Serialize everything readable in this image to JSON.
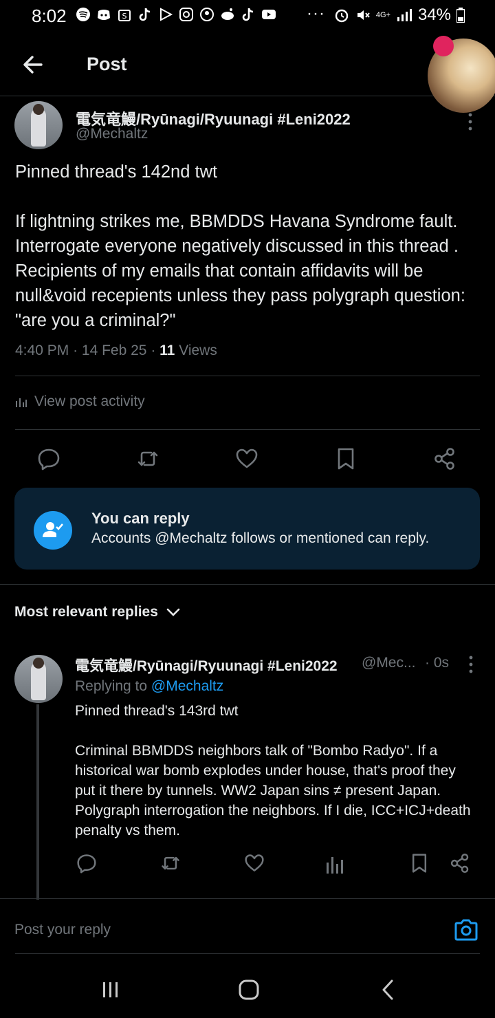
{
  "status_bar": {
    "time": "8:02",
    "overflow": "···",
    "network": "4G+",
    "battery": "34%"
  },
  "header": {
    "title": "Post"
  },
  "post": {
    "author_name": "電気竜鰻/Ryūnagi/Ryuunagi #Leni2022",
    "author_handle": "@Mechaltz",
    "text": "Pinned thread's 142nd twt\n\nIf lightning strikes me, BBMDDS Havana Syndrome fault. Interrogate everyone negatively discussed in this thread . Recipients of my emails that contain affidavits will be null&void recepients unless they pass polygraph question: \"are you a criminal?\"",
    "time": "4:40 PM",
    "date": "14 Feb 25",
    "views_count": "11",
    "views_label": "Views",
    "activity_label": "View post activity"
  },
  "reply_restriction": {
    "title": "You can reply",
    "subtitle": "Accounts @Mechaltz follows or mentioned can reply."
  },
  "replies_filter": {
    "label": "Most relevant replies"
  },
  "reply": {
    "author_name": "電気竜鰻/Ryūnagi/Ryuunagi #Leni2022",
    "author_handle": "@Mec...",
    "time": "· 0s",
    "replying_prefix": "Replying to",
    "replying_to": "@Mechaltz",
    "text": "Pinned thread's 143rd twt\n\nCriminal BBMDDS neighbors talk of \"Bombo Radyo\". If a historical war bomb explodes under house, that's proof they put it there by tunnels. WW2 Japan sins ≠ present Japan. Polygraph interrogation the neighbors. If I die, ICC+ICJ+death penalty vs them."
  },
  "composer": {
    "placeholder": "Post your reply"
  },
  "colors": {
    "background": "#000000",
    "text": "#e7e9ea",
    "muted": "#71767b",
    "accent": "#1d9bf0",
    "card": "#0a2133",
    "divider": "#2f3336"
  }
}
